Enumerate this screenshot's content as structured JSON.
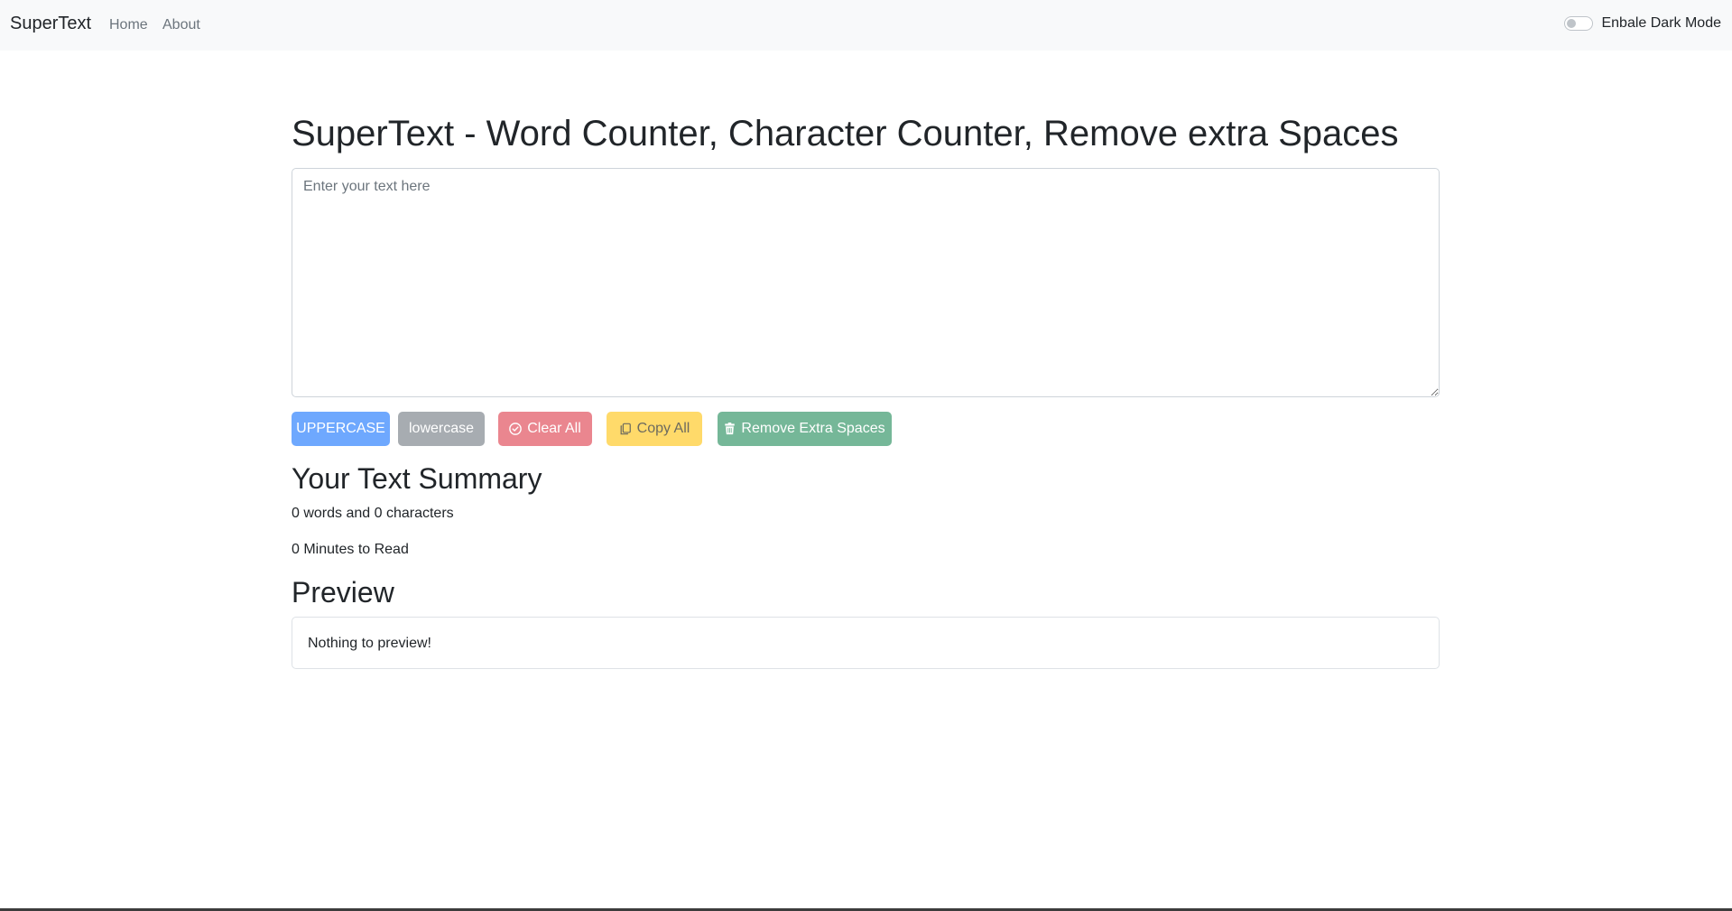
{
  "navbar": {
    "brand": "SuperText",
    "links": [
      "Home",
      "About"
    ],
    "dark_mode_label": "Enbale Dark Mode",
    "dark_mode_enabled": false
  },
  "main": {
    "title": "SuperText - Word Counter, Character Counter, Remove extra Spaces",
    "textarea": {
      "value": "",
      "placeholder": "Enter your text here"
    },
    "buttons": [
      {
        "label": "UPPERCASE",
        "color": "#6ea8fe"
      },
      {
        "label": "lowercase",
        "color": "#a7acb1"
      },
      {
        "label": "Clear All",
        "icon": "check-circle-icon",
        "color": "#ea868f"
      },
      {
        "label": "Copy All",
        "icon": "copy-icon",
        "color": "#ffda6a"
      },
      {
        "label": "Remove Extra Spaces",
        "icon": "trash-icon",
        "color": "#75b798"
      }
    ],
    "summary": {
      "heading": "Your Text Summary",
      "word_char_count": "0 words and 0 characters",
      "read_time": "0 Minutes to Read"
    },
    "preview": {
      "heading": "Preview",
      "content": "Nothing to preview!"
    }
  }
}
